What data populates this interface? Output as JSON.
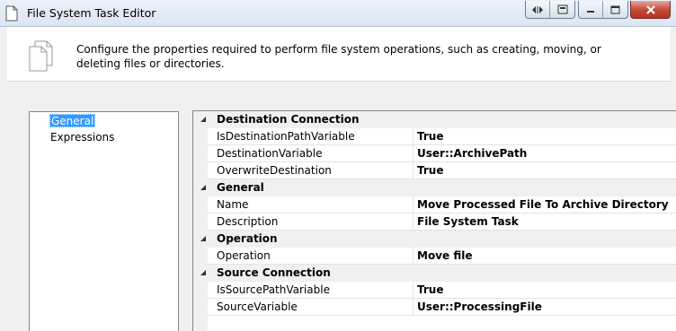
{
  "window": {
    "title": "File System Task Editor",
    "controls": {
      "nav_icon": "split-arrows-icon",
      "pin_icon": "tab-icon",
      "minimize_icon": "minimize-icon",
      "maximize_icon": "maximize-icon",
      "close_icon": "close-icon"
    }
  },
  "header": {
    "description": "Configure the properties required to perform file system operations, such as creating, moving, or deleting files or directories."
  },
  "nav": {
    "items": [
      {
        "label": "General",
        "selected": true
      },
      {
        "label": "Expressions",
        "selected": false
      }
    ]
  },
  "grid": {
    "rows": [
      {
        "kind": "category",
        "label": "Destination Connection"
      },
      {
        "kind": "property",
        "name": "IsDestinationPathVariable",
        "value": "True"
      },
      {
        "kind": "property",
        "name": "DestinationVariable",
        "value": "User::ArchivePath"
      },
      {
        "kind": "property",
        "name": "OverwriteDestination",
        "value": "True"
      },
      {
        "kind": "category",
        "label": "General"
      },
      {
        "kind": "property",
        "name": "Name",
        "value": "Move Processed File To Archive Directory"
      },
      {
        "kind": "property",
        "name": "Description",
        "value": "File System Task"
      },
      {
        "kind": "category",
        "label": "Operation"
      },
      {
        "kind": "property",
        "name": "Operation",
        "value": "Move file"
      },
      {
        "kind": "category",
        "label": "Source Connection"
      },
      {
        "kind": "property",
        "name": "IsSourcePathVariable",
        "value": "True"
      },
      {
        "kind": "property",
        "name": "SourceVariable",
        "value": "User::ProcessingFile"
      }
    ]
  },
  "colors": {
    "selection": "#3399ff",
    "close_button": "#c54c3b",
    "category_background": "#f0f0f0"
  }
}
